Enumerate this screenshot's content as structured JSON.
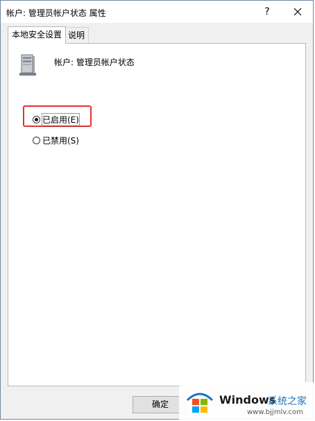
{
  "window": {
    "title": "帐户: 管理员帐户状态 属性",
    "help_label": "?",
    "close_icon": "close-icon"
  },
  "tabs": [
    {
      "label": "本地安全设置",
      "active": true
    },
    {
      "label": "说明",
      "active": false
    }
  ],
  "policy": {
    "icon": "server-policy-icon",
    "name": "帐户: 管理员帐户状态"
  },
  "options": {
    "enabled": {
      "label": "已启用(E)",
      "checked": true
    },
    "disabled": {
      "label": "已禁用(S)",
      "checked": false
    }
  },
  "buttons": {
    "ok_label": "确定"
  },
  "watermark": {
    "brand": "Windows",
    "site_cn": "系统之家",
    "url": "www.bjjmlv.com"
  },
  "colors": {
    "highlight": "#e03131",
    "accent": "#1e73be"
  }
}
